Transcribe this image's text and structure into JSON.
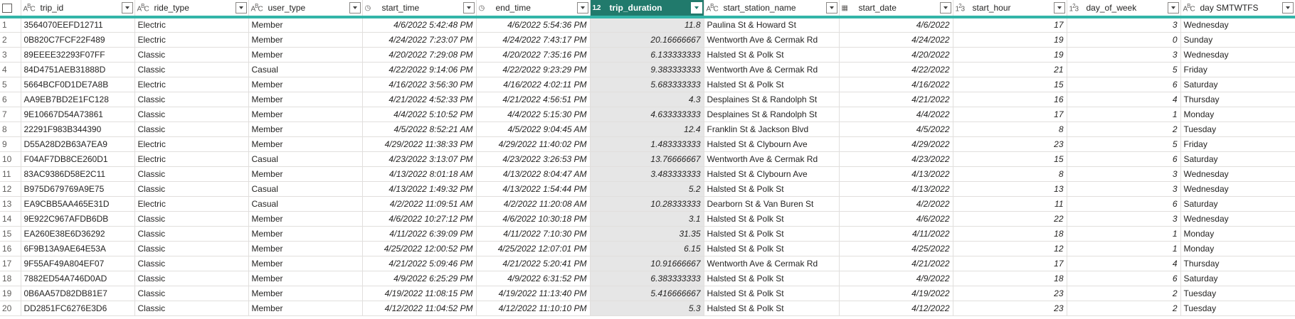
{
  "columns": [
    {
      "type_icon": "ABC",
      "name": "trip_id"
    },
    {
      "type_icon": "ABC",
      "name": "ride_type"
    },
    {
      "type_icon": "ABC",
      "name": "user_type"
    },
    {
      "type_icon": "clock",
      "name": "start_time"
    },
    {
      "type_icon": "clock",
      "name": "end_time"
    },
    {
      "type_icon": "1.2",
      "name": "trip_duration"
    },
    {
      "type_icon": "ABC",
      "name": "start_station_name"
    },
    {
      "type_icon": "calendar",
      "name": "start_date"
    },
    {
      "type_icon": "123",
      "name": "start_hour"
    },
    {
      "type_icon": "123",
      "name": "day_of_week"
    },
    {
      "type_icon": "ABC",
      "name": "day SMTWTFS"
    }
  ],
  "selected_column": "trip_duration",
  "rows": [
    [
      "1",
      "3564070EEFD12711",
      "Electric",
      "Member",
      "4/6/2022 5:42:48 PM",
      "4/6/2022 5:54:36 PM",
      "11.8",
      "Paulina St & Howard St",
      "4/6/2022",
      "17",
      "3",
      "Wednesday"
    ],
    [
      "2",
      "0B820C7FCF22F489",
      "Electric",
      "Member",
      "4/24/2022 7:23:07 PM",
      "4/24/2022 7:43:17 PM",
      "20.16666667",
      "Wentworth Ave & Cermak Rd",
      "4/24/2022",
      "19",
      "0",
      "Sunday"
    ],
    [
      "3",
      "89EEEE32293F07FF",
      "Classic",
      "Member",
      "4/20/2022 7:29:08 PM",
      "4/20/2022 7:35:16 PM",
      "6.133333333",
      "Halsted St & Polk St",
      "4/20/2022",
      "19",
      "3",
      "Wednesday"
    ],
    [
      "4",
      "84D4751AEB31888D",
      "Classic",
      "Casual",
      "4/22/2022 9:14:06 PM",
      "4/22/2022 9:23:29 PM",
      "9.383333333",
      "Wentworth Ave & Cermak Rd",
      "4/22/2022",
      "21",
      "5",
      "Friday"
    ],
    [
      "5",
      "5664BCF0D1DE7A8B",
      "Electric",
      "Member",
      "4/16/2022 3:56:30 PM",
      "4/16/2022 4:02:11 PM",
      "5.683333333",
      "Halsted St & Polk St",
      "4/16/2022",
      "15",
      "6",
      "Saturday"
    ],
    [
      "6",
      "AA9EB7BD2E1FC128",
      "Classic",
      "Member",
      "4/21/2022 4:52:33 PM",
      "4/21/2022 4:56:51 PM",
      "4.3",
      "Desplaines St & Randolph St",
      "4/21/2022",
      "16",
      "4",
      "Thursday"
    ],
    [
      "7",
      "9E10667D54A73861",
      "Classic",
      "Member",
      "4/4/2022 5:10:52 PM",
      "4/4/2022 5:15:30 PM",
      "4.633333333",
      "Desplaines St & Randolph St",
      "4/4/2022",
      "17",
      "1",
      "Monday"
    ],
    [
      "8",
      "22291F983B344390",
      "Classic",
      "Member",
      "4/5/2022 8:52:21 AM",
      "4/5/2022 9:04:45 AM",
      "12.4",
      "Franklin St & Jackson Blvd",
      "4/5/2022",
      "8",
      "2",
      "Tuesday"
    ],
    [
      "9",
      "D55A28D2B63A7EA9",
      "Electric",
      "Member",
      "4/29/2022 11:38:33 PM",
      "4/29/2022 11:40:02 PM",
      "1.483333333",
      "Halsted St & Clybourn Ave",
      "4/29/2022",
      "23",
      "5",
      "Friday"
    ],
    [
      "10",
      "F04AF7DB8CE260D1",
      "Electric",
      "Casual",
      "4/23/2022 3:13:07 PM",
      "4/23/2022 3:26:53 PM",
      "13.76666667",
      "Wentworth Ave & Cermak Rd",
      "4/23/2022",
      "15",
      "6",
      "Saturday"
    ],
    [
      "11",
      "83AC9386D58E2C11",
      "Classic",
      "Member",
      "4/13/2022 8:01:18 AM",
      "4/13/2022 8:04:47 AM",
      "3.483333333",
      "Halsted St & Clybourn Ave",
      "4/13/2022",
      "8",
      "3",
      "Wednesday"
    ],
    [
      "12",
      "B975D679769A9E75",
      "Classic",
      "Casual",
      "4/13/2022 1:49:32 PM",
      "4/13/2022 1:54:44 PM",
      "5.2",
      "Halsted St & Polk St",
      "4/13/2022",
      "13",
      "3",
      "Wednesday"
    ],
    [
      "13",
      "EA9CBB5AA465E31D",
      "Electric",
      "Casual",
      "4/2/2022 11:09:51 AM",
      "4/2/2022 11:20:08 AM",
      "10.28333333",
      "Dearborn St & Van Buren St",
      "4/2/2022",
      "11",
      "6",
      "Saturday"
    ],
    [
      "14",
      "9E922C967AFDB6DB",
      "Classic",
      "Member",
      "4/6/2022 10:27:12 PM",
      "4/6/2022 10:30:18 PM",
      "3.1",
      "Halsted St & Polk St",
      "4/6/2022",
      "22",
      "3",
      "Wednesday"
    ],
    [
      "15",
      "EA260E38E6D36292",
      "Classic",
      "Member",
      "4/11/2022 6:39:09 PM",
      "4/11/2022 7:10:30 PM",
      "31.35",
      "Halsted St & Polk St",
      "4/11/2022",
      "18",
      "1",
      "Monday"
    ],
    [
      "16",
      "6F9B13A9AE64E53A",
      "Classic",
      "Member",
      "4/25/2022 12:00:52 PM",
      "4/25/2022 12:07:01 PM",
      "6.15",
      "Halsted St & Polk St",
      "4/25/2022",
      "12",
      "1",
      "Monday"
    ],
    [
      "17",
      "9F55AF49A804EF07",
      "Classic",
      "Member",
      "4/21/2022 5:09:46 PM",
      "4/21/2022 5:20:41 PM",
      "10.91666667",
      "Wentworth Ave & Cermak Rd",
      "4/21/2022",
      "17",
      "4",
      "Thursday"
    ],
    [
      "18",
      "7882ED54A746D0AD",
      "Classic",
      "Member",
      "4/9/2022 6:25:29 PM",
      "4/9/2022 6:31:52 PM",
      "6.383333333",
      "Halsted St & Polk St",
      "4/9/2022",
      "18",
      "6",
      "Saturday"
    ],
    [
      "19",
      "0B6AA57D82DB81E7",
      "Classic",
      "Member",
      "4/19/2022 11:08:15 PM",
      "4/19/2022 11:13:40 PM",
      "5.416666667",
      "Halsted St & Polk St",
      "4/19/2022",
      "23",
      "2",
      "Tuesday"
    ],
    [
      "20",
      "DD2851FC6276E3D6",
      "Classic",
      "Member",
      "4/12/2022 11:04:52 PM",
      "4/12/2022 11:10:10 PM",
      "5.3",
      "Halsted St & Polk St",
      "4/12/2022",
      "23",
      "2",
      "Tuesday"
    ]
  ],
  "colors": {
    "accent": "#33b5a8",
    "selected_header": "#217a6c",
    "selected_column_bg": "#e6e6e6"
  }
}
